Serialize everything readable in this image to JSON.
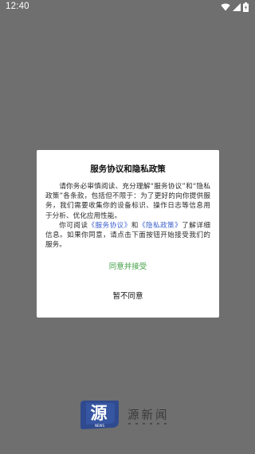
{
  "status_bar": {
    "time": "12:40",
    "icons": [
      "wifi-icon",
      "cellular-signal-icon",
      "battery-icon"
    ]
  },
  "dialog": {
    "title": "服务协议和隐私政策",
    "paragraph1": "请你务必审慎阅读、充分理解“服务协议”和“隐私政策”各条款，包括但不限于：为了更好的向你提供服务，我们需要收集你的设备标识、操作日志等信息用于分析、优化应用性能。",
    "paragraph2_prefix": "你可阅读",
    "service_link": "《服务协议》",
    "and_text": "和",
    "privacy_link": "《隐私政策》",
    "paragraph2_suffix": "了解详细信息。如果你同意，请点击下面按钮开始接受我们的服务。",
    "agree_button": "同意并接受",
    "disagree_button": "暂不同意"
  },
  "brand": {
    "badge_text": "源",
    "badge_subtext": "NEWS",
    "name": "源新闻"
  },
  "colors": {
    "background": "#6f6f6f",
    "agree": "#43a047",
    "link": "#3a5fcd",
    "badge": "#2f4a8f"
  }
}
